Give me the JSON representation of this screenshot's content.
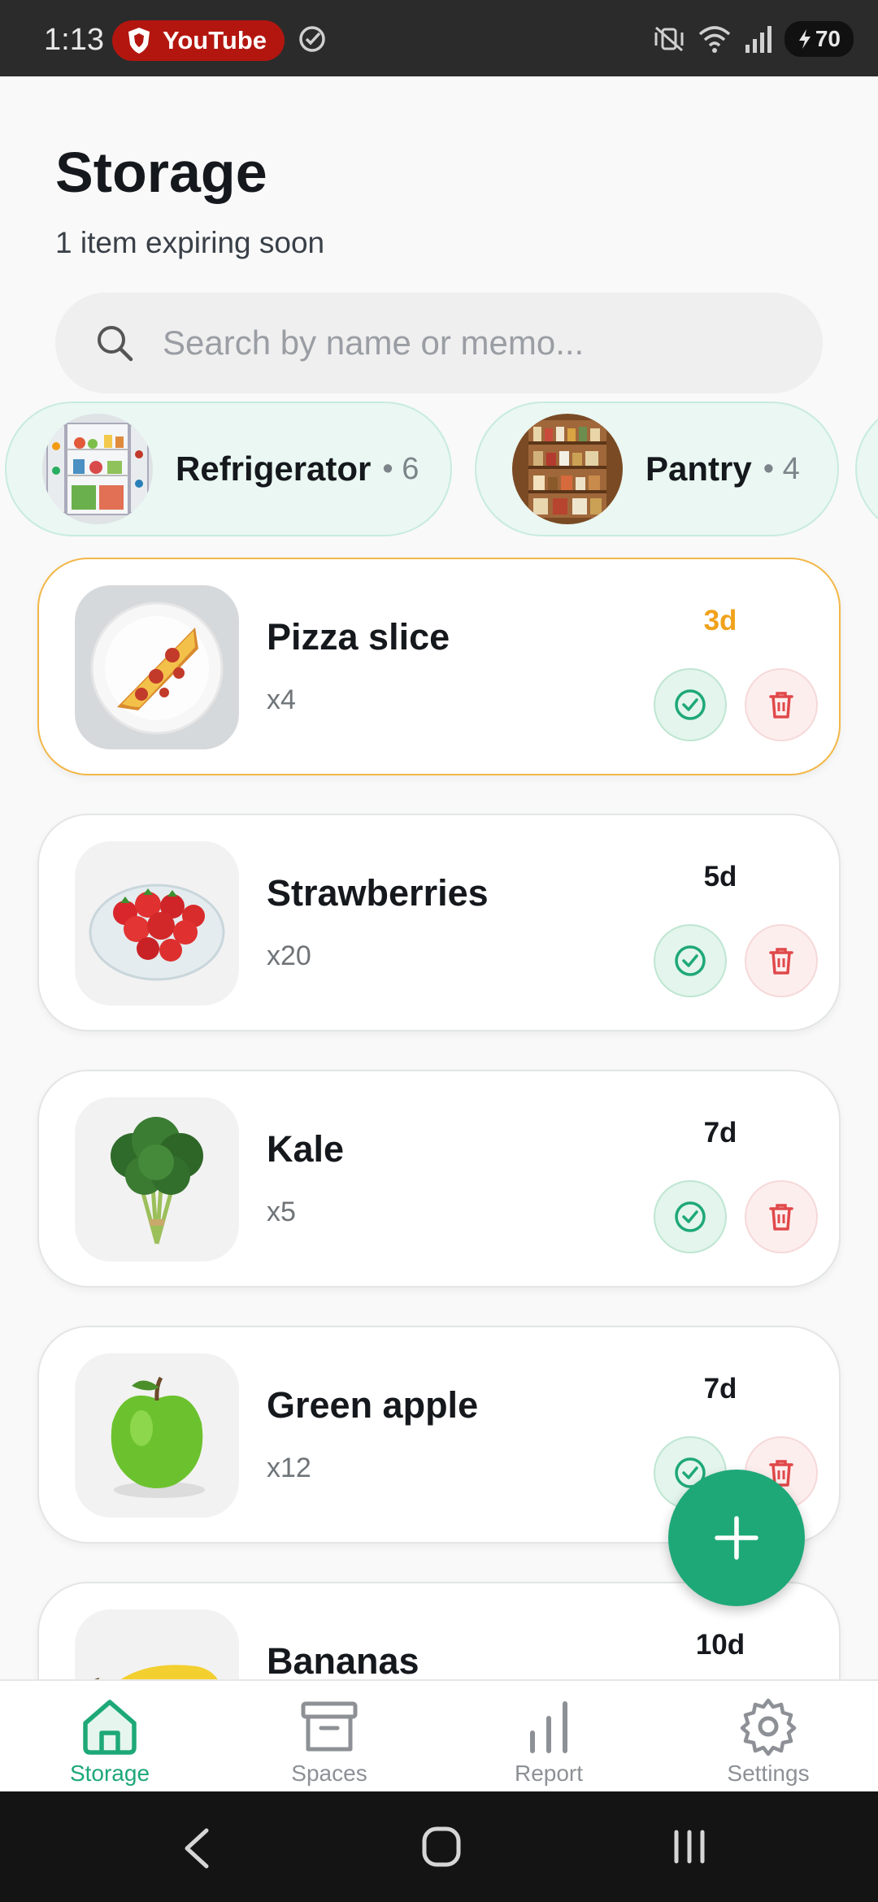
{
  "status_bar": {
    "time": "1:13",
    "app_pill": "YouTube",
    "battery": "70"
  },
  "header": {
    "title": "Storage",
    "subtitle": "1 item expiring soon"
  },
  "search": {
    "placeholder": "Search by name or memo...",
    "value": ""
  },
  "spaces": [
    {
      "name": "Refrigerator",
      "count": "• 6"
    },
    {
      "name": "Pantry",
      "count": "• 4"
    }
  ],
  "items": [
    {
      "name": "Pizza slice",
      "qty": "x4",
      "days": "3d"
    },
    {
      "name": "Strawberries",
      "qty": "x20",
      "days": "5d"
    },
    {
      "name": "Kale",
      "qty": "x5",
      "days": "7d"
    },
    {
      "name": "Green apple",
      "qty": "x12",
      "days": "7d"
    },
    {
      "name": "Bananas",
      "qty": "",
      "days": "10d"
    }
  ],
  "bottom_nav": [
    {
      "label": "Storage",
      "icon": "home-icon",
      "active": true
    },
    {
      "label": "Spaces",
      "icon": "archive-box-icon",
      "active": false
    },
    {
      "label": "Report",
      "icon": "bar-chart-icon",
      "active": false
    },
    {
      "label": "Settings",
      "icon": "gear-icon",
      "active": false
    }
  ],
  "colors": {
    "accent": "#1ea878",
    "warning": "#f0a21b",
    "danger": "#e0484a"
  }
}
